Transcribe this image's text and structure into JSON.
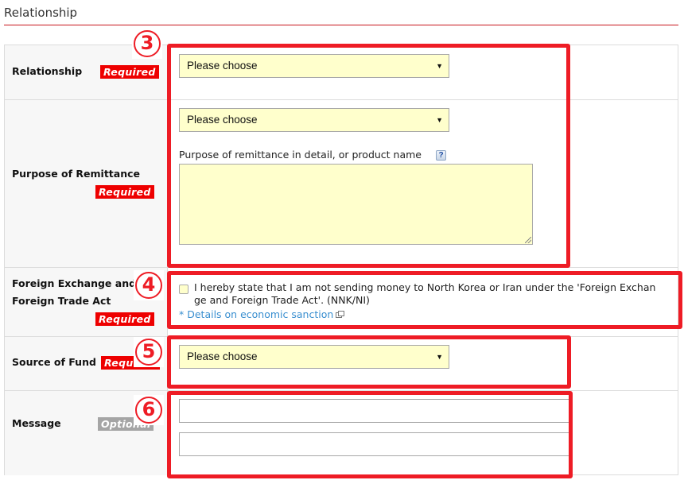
{
  "section": {
    "title": "Relationship"
  },
  "badges": {
    "required": "Required",
    "optional": "Optional"
  },
  "rows": {
    "relationship": {
      "label": "Relationship",
      "badge": "Required",
      "select_value": "Please choose"
    },
    "purpose": {
      "label": "Purpose of Remittance",
      "badge": "Required",
      "select_value": "Please choose",
      "detail_caption": "Purpose of remittance in detail, or product name",
      "help_icon": "?",
      "detail_value": ""
    },
    "foreign_exchange": {
      "label_line1": "Foreign Exchange and",
      "label_line2": "Foreign Trade Act",
      "badge": "Required",
      "declaration_line1": "I hereby state that I am not sending money to North Korea or Iran under the 'Foreign Exchan",
      "declaration_line2": "ge and Foreign Trade Act'. (NNK/NI)",
      "checked": false,
      "link_text": "* Details on economic sanction"
    },
    "source_of_fund": {
      "label": "Source of Fund",
      "badge": "Required",
      "select_value": "Please choose"
    },
    "message": {
      "label": "Message",
      "badge": "Optional",
      "line1_value": "",
      "line2_value": ""
    }
  },
  "annotations": [
    {
      "number": "3",
      "target": "relationship-and-purpose"
    },
    {
      "number": "4",
      "target": "foreign-exchange-declaration"
    },
    {
      "number": "5",
      "target": "source-of-fund"
    },
    {
      "number": "6",
      "target": "message"
    }
  ],
  "colors": {
    "accent_red": "#ee1c25",
    "required_badge": "#ee0000",
    "optional_badge": "#a5a5a5",
    "input_fill": "#ffffcc",
    "link": "#3a8fd0",
    "label_bg": "#f7f7f7"
  }
}
